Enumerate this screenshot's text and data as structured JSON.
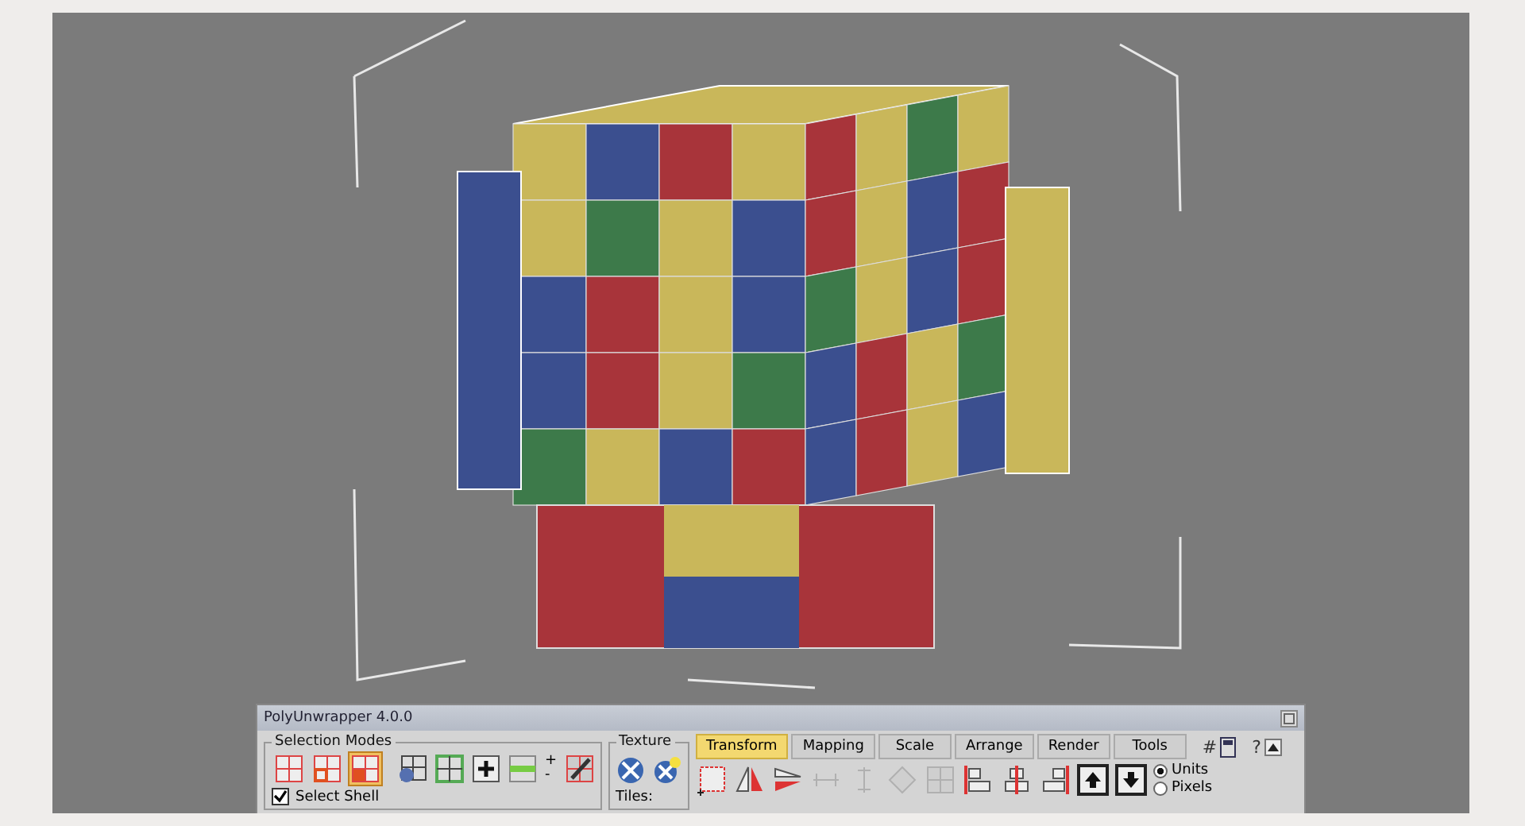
{
  "window": {
    "title": "PolyUnwrapper 4.0.0"
  },
  "selection_modes": {
    "title": "Selection Modes",
    "modes": [
      {
        "selected": false
      },
      {
        "selected": false
      },
      {
        "selected": true
      }
    ],
    "select_shell": {
      "label": "Select Shell",
      "checked": true
    },
    "plus": "+",
    "minus": "-"
  },
  "texture": {
    "title": "Texture",
    "tiles_label": "Tiles:"
  },
  "tabs": [
    {
      "label": "Transform",
      "selected": true
    },
    {
      "label": "Mapping",
      "selected": false
    },
    {
      "label": "Scale",
      "selected": false
    },
    {
      "label": "Arrange",
      "selected": false
    },
    {
      "label": "Render",
      "selected": false
    },
    {
      "label": "Tools",
      "selected": false
    }
  ],
  "toolbar": {
    "hash": "#",
    "help": "?"
  },
  "units": [
    {
      "label": "Units",
      "selected": true
    },
    {
      "label": "Pixels",
      "selected": false
    }
  ]
}
